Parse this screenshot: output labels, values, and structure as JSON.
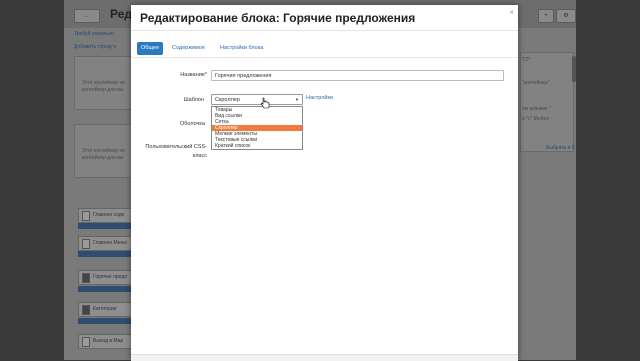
{
  "background": {
    "header_title_fragment": "Ред",
    "nav_button": "←",
    "left_text_1": "Требуй локально",
    "left_link_1": "Добавить строку к",
    "left_hint_1": "Этот контейнер не",
    "left_hint_1b": "контейнер для вы",
    "left_hint_2": "Этот контейнер не",
    "left_hint_2b": "контейнер для вы",
    "right_text_1": "ТЭ\"",
    "right_text_2": "\"контейнер\"",
    "right_text_3": "ом режиме \"",
    "right_text_4": "а \"с\" Мобил",
    "right_link": "Выбрать в б",
    "rows": [
      "Главное соде",
      "Главное Меню",
      "Горячие предл",
      "Категории",
      "Выход в Мар"
    ]
  },
  "modal": {
    "title": "Редактирование блока: Горячие предложения",
    "close_icon_glyph": "×",
    "tabs": [
      {
        "label": "Общее",
        "active": true
      },
      {
        "label": "Содержимое",
        "active": false
      },
      {
        "label": "Настройки блока",
        "active": false
      }
    ],
    "form": {
      "name_label": "Название",
      "required_mark": "*",
      "name_value": "Горячие предложения",
      "template_label": "Шаблон",
      "template_selected": "Скроллер",
      "template_caret": "▼",
      "settings_link": "Настройки",
      "wrapper_label": "Оболочка",
      "css_label_line1": "Пользовательский CSS-",
      "css_label_line2": "класс"
    },
    "dropdown_options": [
      {
        "label": "Товары",
        "selected": false
      },
      {
        "label": "Вид ссылки",
        "selected": false
      },
      {
        "label": "Сетка",
        "selected": false
      },
      {
        "label": "Скроллер",
        "selected": true
      },
      {
        "label": "Мелкие элементы",
        "selected": false
      },
      {
        "label": "Текстовые ссылки",
        "selected": false
      },
      {
        "label": "Краткий список",
        "selected": false
      }
    ]
  },
  "colors": {
    "accent": "#2a7ac0",
    "dropdown_highlight": "#f07c3b",
    "overlay": "#3a3a3a"
  }
}
